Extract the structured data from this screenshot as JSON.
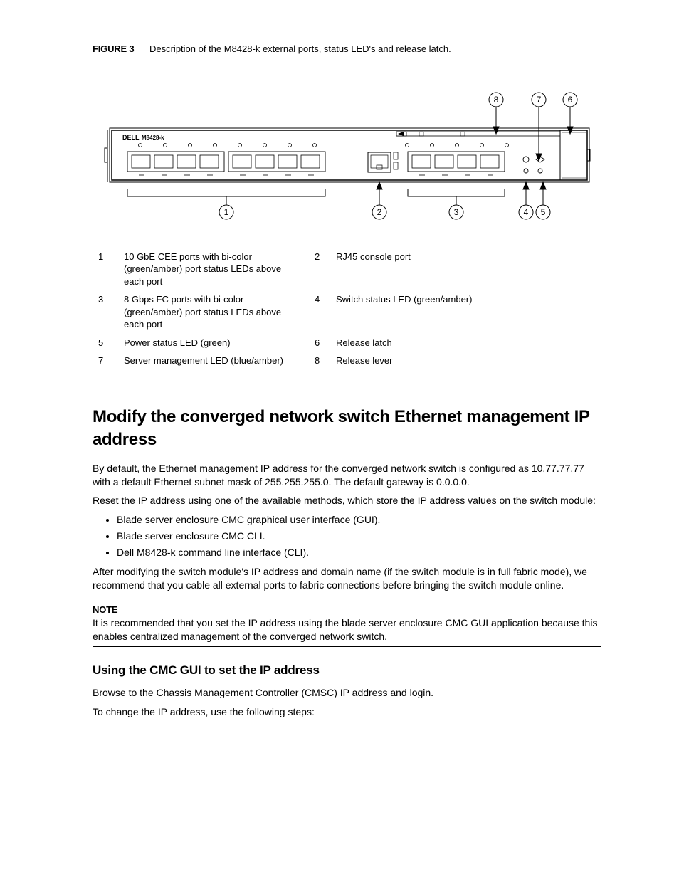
{
  "figure": {
    "label": "FIGURE 3",
    "caption": "Description of the M8428-k external ports, status LED's and release latch.",
    "device_label": "M8428-k",
    "brand": "DELL"
  },
  "legend": [
    {
      "n1": "1",
      "t1": "10 GbE CEE ports with bi-color (green/amber) port status LEDs above each port",
      "n2": "2",
      "t2": "RJ45 console port"
    },
    {
      "n1": "3",
      "t1": "8 Gbps FC ports with bi-color (green/amber) port status LEDs above each port",
      "n2": "4",
      "t2": "Switch status LED (green/amber)"
    },
    {
      "n1": "5",
      "t1": "Power status LED (green)",
      "n2": "6",
      "t2": "Release latch"
    },
    {
      "n1": "7",
      "t1": "Server management LED (blue/amber)",
      "n2": "8",
      "t2": "Release lever"
    }
  ],
  "section": {
    "h1": "Modify the converged network switch Ethernet management IP address",
    "p1": "By default, the Ethernet management IP address for the converged network switch is configured as 10.77.77.77 with a default Ethernet subnet mask of 255.255.255.0. The default gateway is 0.0.0.0.",
    "p2": "Reset the IP address using one of the available methods, which store the IP address values on the switch module:",
    "bullets": [
      "Blade server enclosure CMC graphical user interface (GUI).",
      "Blade server enclosure CMC CLI.",
      "Dell M8428-k command line interface (CLI)."
    ],
    "p3": "After modifying the switch module's IP address and domain name (if the switch module is in full fabric mode), we recommend that you cable all external ports to fabric connections before bringing the switch module online."
  },
  "note": {
    "label": "NOTE",
    "text": "It is recommended that you set the IP address using the blade server enclosure CMC GUI application because this enables centralized management of the converged network switch."
  },
  "subsection": {
    "h2": "Using the CMC GUI to set the IP address",
    "p1": "Browse to the Chassis Management Controller (CMSC) IP address and login.",
    "p2": "To change the IP address, use the following steps:"
  }
}
